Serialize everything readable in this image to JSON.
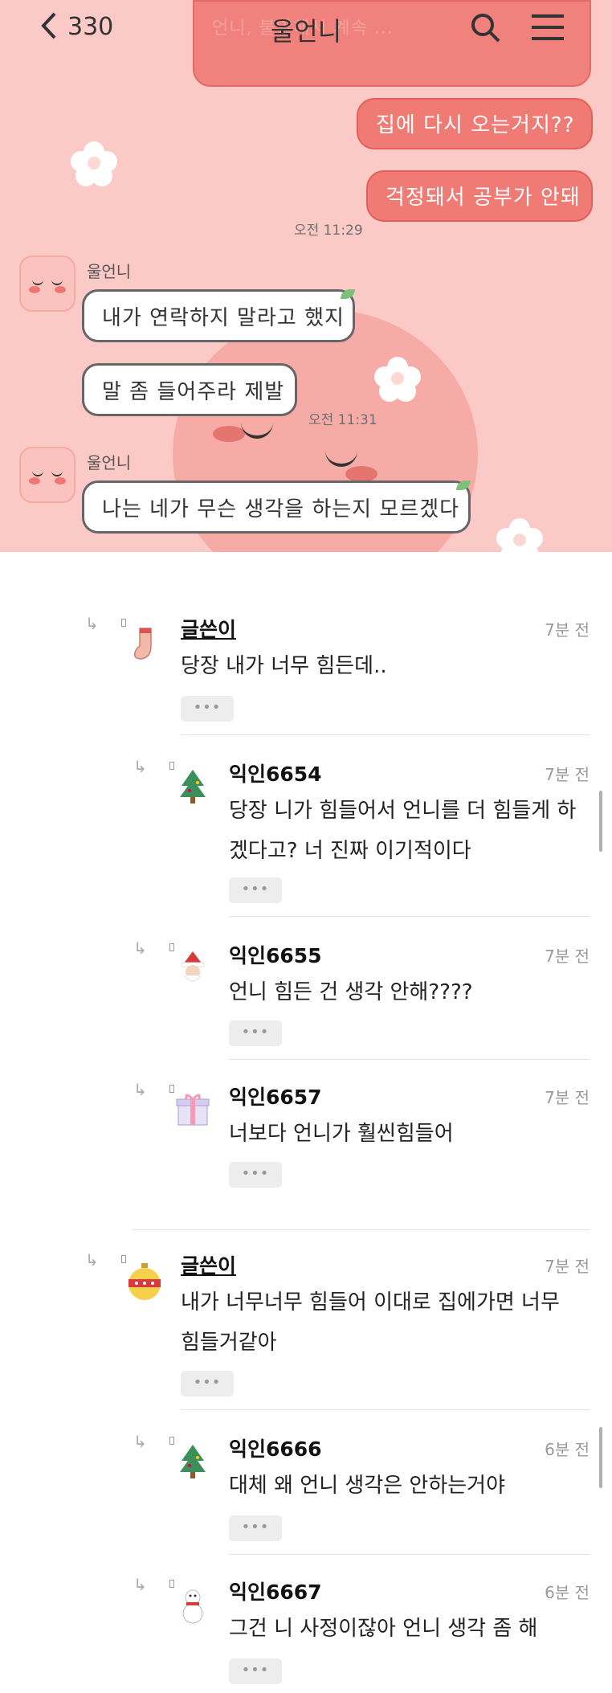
{
  "chat": {
    "back_count": "330",
    "title": "울언니",
    "header_overlap_text": "언니, 불안해서 계속 ...",
    "messages_me": [
      {
        "text": "집에 다시 오는거지??"
      },
      {
        "text": "걱정돼서 공부가 안돼"
      }
    ],
    "time_1": "오전 11:29",
    "sender_1": "울언니",
    "messages_them_1": [
      {
        "text": "내가 연락하지 말라고 했지"
      },
      {
        "text": "말 좀 들어주라 제발"
      }
    ],
    "time_2": "오전 11:31",
    "sender_2": "울언니",
    "messages_them_2": [
      {
        "text": "나는 네가 무슨 생각을 하는지 모르겠다"
      }
    ]
  },
  "comments": {
    "more_label": "•••",
    "items": [
      {
        "author": "글쓴이",
        "time": "7분 전",
        "lines": [
          "당장 내가 너무 힘든데.."
        ],
        "icon": "sock-icon"
      },
      {
        "author": "익인6654",
        "time": "7분 전",
        "lines": [
          "당장 니가 힘들어서 언니를 더 힘들게 하",
          "겠다고? 너 진짜 이기적이다"
        ],
        "icon": "tree-icon"
      },
      {
        "author": "익인6655",
        "time": "7분 전",
        "lines": [
          "언니 힘든 건 생각 안해????"
        ],
        "icon": "santa-icon"
      },
      {
        "author": "익인6657",
        "time": "7분 전",
        "lines": [
          "너보다 언니가 훨씬힘들어"
        ],
        "icon": "gift-icon"
      },
      {
        "author": "글쓴이",
        "time": "7분 전",
        "lines": [
          "내가 너무너무 힘들어 이대로 집에가면 너무",
          "힘들거같아"
        ],
        "icon": "ornament-icon"
      },
      {
        "author": "익인6666",
        "time": "6분 전",
        "lines": [
          "대체 왜 언니 생각은 안하는거야"
        ],
        "icon": "tree-icon"
      },
      {
        "author": "익인6667",
        "time": "6분 전",
        "lines": [
          "그건 니 사정이잖아 언니 생각 좀 해"
        ],
        "icon": "snowman-icon"
      }
    ]
  },
  "colors": {
    "chat_bg": "#fbc9c6",
    "my_bubble": "#f07a74",
    "their_bubble": "#ffffff"
  }
}
